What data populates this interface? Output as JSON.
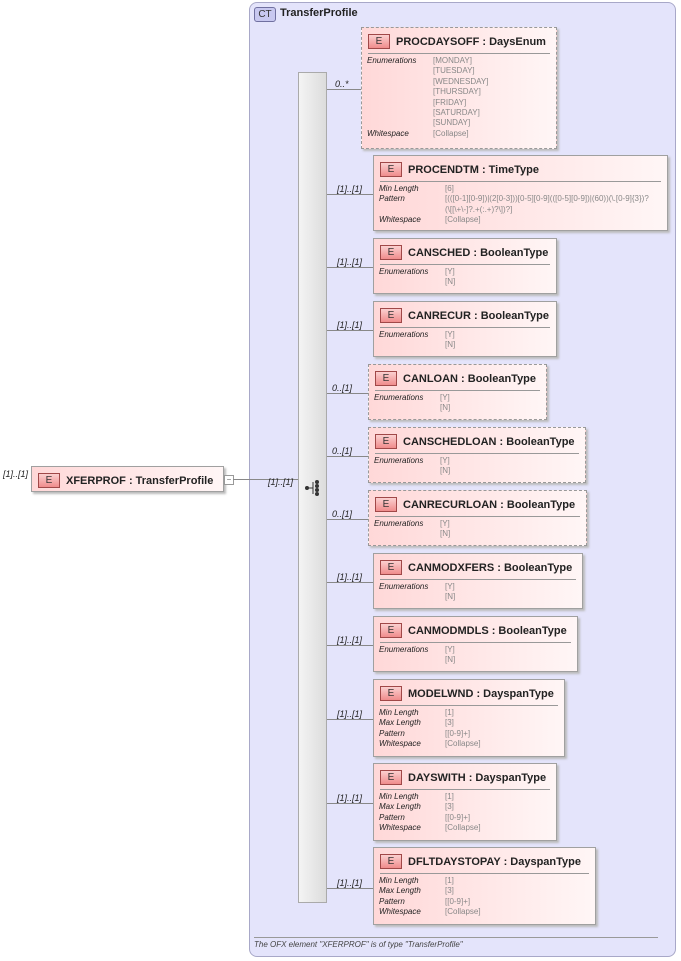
{
  "root": {
    "multiplicity": "[1]..[1]",
    "badge": "E",
    "name": "XFERPROF : TransferProfile",
    "seq_multiplicity": "[1]..[1]"
  },
  "complex_type": {
    "badge": "CT",
    "name": "TransferProfile"
  },
  "elements": [
    {
      "name": "PROCDAYSOFF : DaysEnum",
      "mult": "0..*",
      "optional": true,
      "facets": [
        {
          "label": "Enumerations",
          "values": [
            "[MONDAY]",
            "[TUESDAY]",
            "[WEDNESDAY]",
            "[THURSDAY]",
            "[FRIDAY]",
            "[SATURDAY]",
            "[SUNDAY]"
          ]
        },
        {
          "label": "Whitespace",
          "values": [
            "[Collapse]"
          ]
        }
      ]
    },
    {
      "name": "PROCENDTM : TimeType",
      "mult": "[1]..[1]",
      "optional": false,
      "facets": [
        {
          "label": "Min Length",
          "values": [
            "[6]"
          ]
        },
        {
          "label": "Pattern",
          "values": [
            "[(([0-1][0-9])|(2[0-3]))[0-5][0-9](([0-5][0-9])|(60))(\\.[0-9]{3})?",
            "(\\[[\\+\\-]?.+(:.+)?\\])?]"
          ]
        },
        {
          "label": "Whitespace",
          "values": [
            "[Collapse]"
          ]
        }
      ]
    },
    {
      "name": "CANSCHED : BooleanType",
      "mult": "[1]..[1]",
      "optional": false,
      "facets": [
        {
          "label": "Enumerations",
          "values": [
            "[Y]",
            "[N]"
          ]
        }
      ]
    },
    {
      "name": "CANRECUR : BooleanType",
      "mult": "[1]..[1]",
      "optional": false,
      "facets": [
        {
          "label": "Enumerations",
          "values": [
            "[Y]",
            "[N]"
          ]
        }
      ]
    },
    {
      "name": "CANLOAN : BooleanType",
      "mult": "0..[1]",
      "optional": true,
      "facets": [
        {
          "label": "Enumerations",
          "values": [
            "[Y]",
            "[N]"
          ]
        }
      ]
    },
    {
      "name": "CANSCHEDLOAN : BooleanType",
      "mult": "0..[1]",
      "optional": true,
      "facets": [
        {
          "label": "Enumerations",
          "values": [
            "[Y]",
            "[N]"
          ]
        }
      ]
    },
    {
      "name": "CANRECURLOAN : BooleanType",
      "mult": "0..[1]",
      "optional": true,
      "facets": [
        {
          "label": "Enumerations",
          "values": [
            "[Y]",
            "[N]"
          ]
        }
      ]
    },
    {
      "name": "CANMODXFERS : BooleanType",
      "mult": "[1]..[1]",
      "optional": false,
      "facets": [
        {
          "label": "Enumerations",
          "values": [
            "[Y]",
            "[N]"
          ]
        }
      ]
    },
    {
      "name": "CANMODMDLS : BooleanType",
      "mult": "[1]..[1]",
      "optional": false,
      "facets": [
        {
          "label": "Enumerations",
          "values": [
            "[Y]",
            "[N]"
          ]
        }
      ]
    },
    {
      "name": "MODELWND : DayspanType",
      "mult": "[1]..[1]",
      "optional": false,
      "facets": [
        {
          "label": "Min Length",
          "values": [
            "[1]"
          ]
        },
        {
          "label": "Max Length",
          "values": [
            "[3]"
          ]
        },
        {
          "label": "Pattern",
          "values": [
            "[[0-9]+]"
          ]
        },
        {
          "label": "Whitespace",
          "values": [
            "[Collapse]"
          ]
        }
      ]
    },
    {
      "name": "DAYSWITH : DayspanType",
      "mult": "[1]..[1]",
      "optional": false,
      "facets": [
        {
          "label": "Min Length",
          "values": [
            "[1]"
          ]
        },
        {
          "label": "Max Length",
          "values": [
            "[3]"
          ]
        },
        {
          "label": "Pattern",
          "values": [
            "[[0-9]+]"
          ]
        },
        {
          "label": "Whitespace",
          "values": [
            "[Collapse]"
          ]
        }
      ]
    },
    {
      "name": "DFLTDAYSTOPAY : DayspanType",
      "mult": "[1]..[1]",
      "optional": false,
      "facets": [
        {
          "label": "Min Length",
          "values": [
            "[1]"
          ]
        },
        {
          "label": "Max Length",
          "values": [
            "[3]"
          ]
        },
        {
          "label": "Pattern",
          "values": [
            "[[0-9]+]"
          ]
        },
        {
          "label": "Whitespace",
          "values": [
            "[Collapse]"
          ]
        }
      ]
    }
  ],
  "element_badge": "E",
  "footer": "The OFX element \"XFERPROF\" is of type \"TransferProfile\""
}
